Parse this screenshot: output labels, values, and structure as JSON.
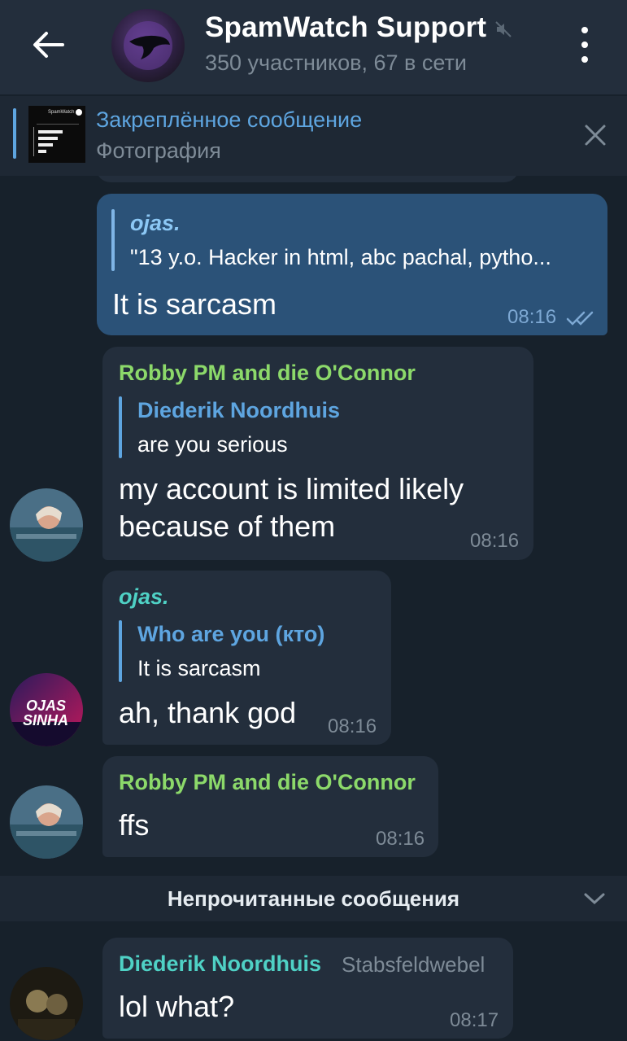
{
  "header": {
    "title": "SpamWatch Support",
    "subtitle": "350 участников, 67 в сети",
    "icons": {
      "back": "arrow-left-icon",
      "mute": "mute-icon",
      "menu": "more-vertical-icon"
    }
  },
  "pinned": {
    "title": "Закреплённое сообщение",
    "text": "Фотография",
    "thumb_title": "SpamWatch"
  },
  "messages": [
    {
      "reply_name": "ojas.",
      "reply_text": "\"13 y.o. Hacker in html, abc pachal, pytho...",
      "text": "It is sarcasm",
      "time": "08:16",
      "status": "read-double-check"
    },
    {
      "sender": "Robby PM and die O'Connor",
      "reply_name": "Diederik Noordhuis",
      "reply_text": "are you serious",
      "text_line1": "my account is limited likely",
      "text_line2": "because of them",
      "time": "08:16"
    },
    {
      "sender": "ojas.",
      "reply_name": "Who are you (кто)",
      "reply_text": "It is sarcasm",
      "text": "ah, thank god",
      "time": "08:16",
      "avatar_text_1": "OJAS",
      "avatar_text_2": "SINHA"
    },
    {
      "sender": "Robby PM and die O'Connor",
      "text": "ffs",
      "time": "08:16"
    },
    {
      "sender": "Diederik Noordhuis",
      "rank": "Stabsfeldwebel",
      "text": "lol what?",
      "time": "08:17"
    }
  ],
  "unread": {
    "label": "Непрочитанные сообщения"
  },
  "colors": {
    "background": "#17212b",
    "header": "#232e3c",
    "incoming_bubble": "#232e3c",
    "outgoing_bubble": "#2b5278",
    "accent_blue": "#5ea5e0",
    "sender_green": "#8cd96a",
    "sender_teal": "#4fd1c5"
  }
}
